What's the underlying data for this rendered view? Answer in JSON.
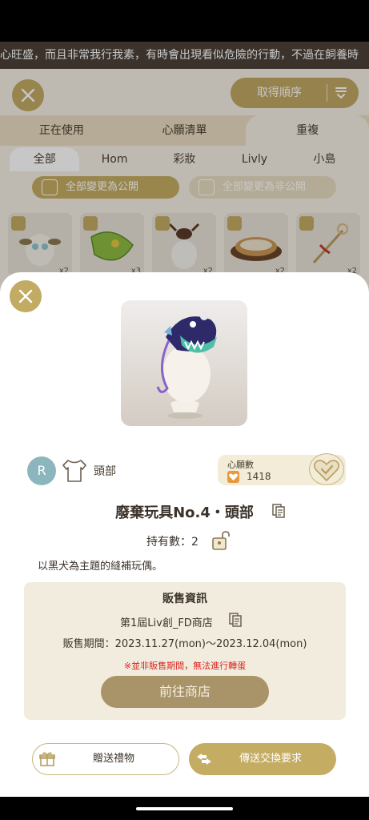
{
  "background": {
    "marquee_text": "心旺盛，而且非常我行我素，有時會出現看似危險的行動，不過在飼養時",
    "sort_button_label": "取得順序",
    "main_tabs": [
      {
        "label": "正在使用"
      },
      {
        "label": "心願清單"
      },
      {
        "label": "重複"
      }
    ],
    "sub_tabs": [
      {
        "label": "全部"
      },
      {
        "label": "Hom"
      },
      {
        "label": "彩妝"
      },
      {
        "label": "Livly"
      },
      {
        "label": "小島"
      }
    ],
    "make_public_label": "全部變更為公開",
    "make_private_label": "全部變更為非公開",
    "grid_items": [
      {
        "name": "white-creature-item",
        "count": "x2"
      },
      {
        "name": "green-leaf-item",
        "count": "x3"
      },
      {
        "name": "antler-hat-item",
        "count": "x2"
      },
      {
        "name": "bread-item",
        "count": "x2"
      },
      {
        "name": "ribbon-wand-item",
        "count": "x2"
      }
    ]
  },
  "detail": {
    "rarity": "R",
    "slot_label": "頭部",
    "wishlist_title": "心願數",
    "wishlist_count": "1418",
    "item_name": "廢棄玩具No.4・頭部",
    "owned_text": "持有數：2",
    "description": "以黑犬為主題的縫補玩偶。",
    "sale": {
      "title": "販售資訊",
      "shop_name": "第1屆Liv創_FD商店",
      "period": "販售期間：2023.11.27(mon)〜2023.12.04(mon)",
      "warning": "※並非販售期間，無法進行轉蛋",
      "go_to_shop_label": "前往商店"
    },
    "gift_button_label": "贈送禮物",
    "trade_button_label": "傳送交換要求"
  },
  "colors": {
    "gold": "#c4ac63",
    "gold_dark": "#a89468",
    "rarity_blue": "#8bb6be",
    "warning_red": "#d9251f",
    "sale_bg": "#f2ecdf"
  }
}
